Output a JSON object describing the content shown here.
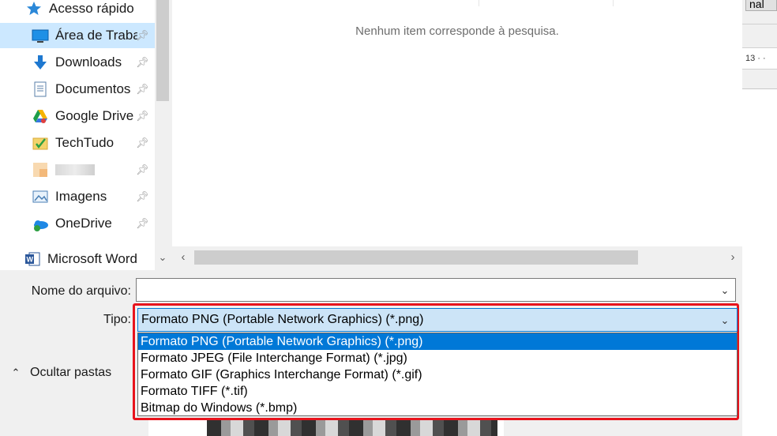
{
  "background_window": {
    "button_fragment": "nal",
    "ruler_fragment": "13 · ·"
  },
  "nav": {
    "quick_access": "Acesso rápido",
    "items": [
      {
        "label": "Área de Trabalho",
        "icon": "desktop-icon",
        "pinned": true,
        "selected": true
      },
      {
        "label": "Downloads",
        "icon": "download-icon",
        "pinned": true
      },
      {
        "label": "Documentos",
        "icon": "document-icon",
        "pinned": true
      },
      {
        "label": "Google Drive",
        "icon": "google-drive-icon",
        "pinned": true
      },
      {
        "label": "TechTudo",
        "icon": "folder-icon",
        "pinned": true
      },
      {
        "label": "",
        "icon": "folder-icon",
        "pinned": true
      },
      {
        "label": "Imagens",
        "icon": "pictures-icon",
        "pinned": true
      },
      {
        "label": "OneDrive",
        "icon": "onedrive-icon",
        "pinned": true
      }
    ],
    "word": "Microsoft Word"
  },
  "filelist": {
    "empty_message": "Nenhum item corresponde à pesquisa."
  },
  "form": {
    "filename_label": "Nome do arquivo:",
    "filename_value": "",
    "type_label": "Tipo:",
    "type_selected": "Formato PNG (Portable Network Graphics) (*.png)",
    "type_options": [
      "Formato PNG (Portable Network Graphics) (*.png)",
      "Formato JPEG (File Interchange Format) (*.jpg)",
      "Formato GIF (Graphics Interchange Format) (*.gif)",
      "Formato TIFF (*.tif)",
      "Bitmap do Windows (*.bmp)"
    ],
    "hide_folders": "Ocultar pastas"
  },
  "colors": {
    "selection_blue": "#0078d7",
    "highlight_red": "#e8131c",
    "nav_selected": "#cce8ff"
  }
}
